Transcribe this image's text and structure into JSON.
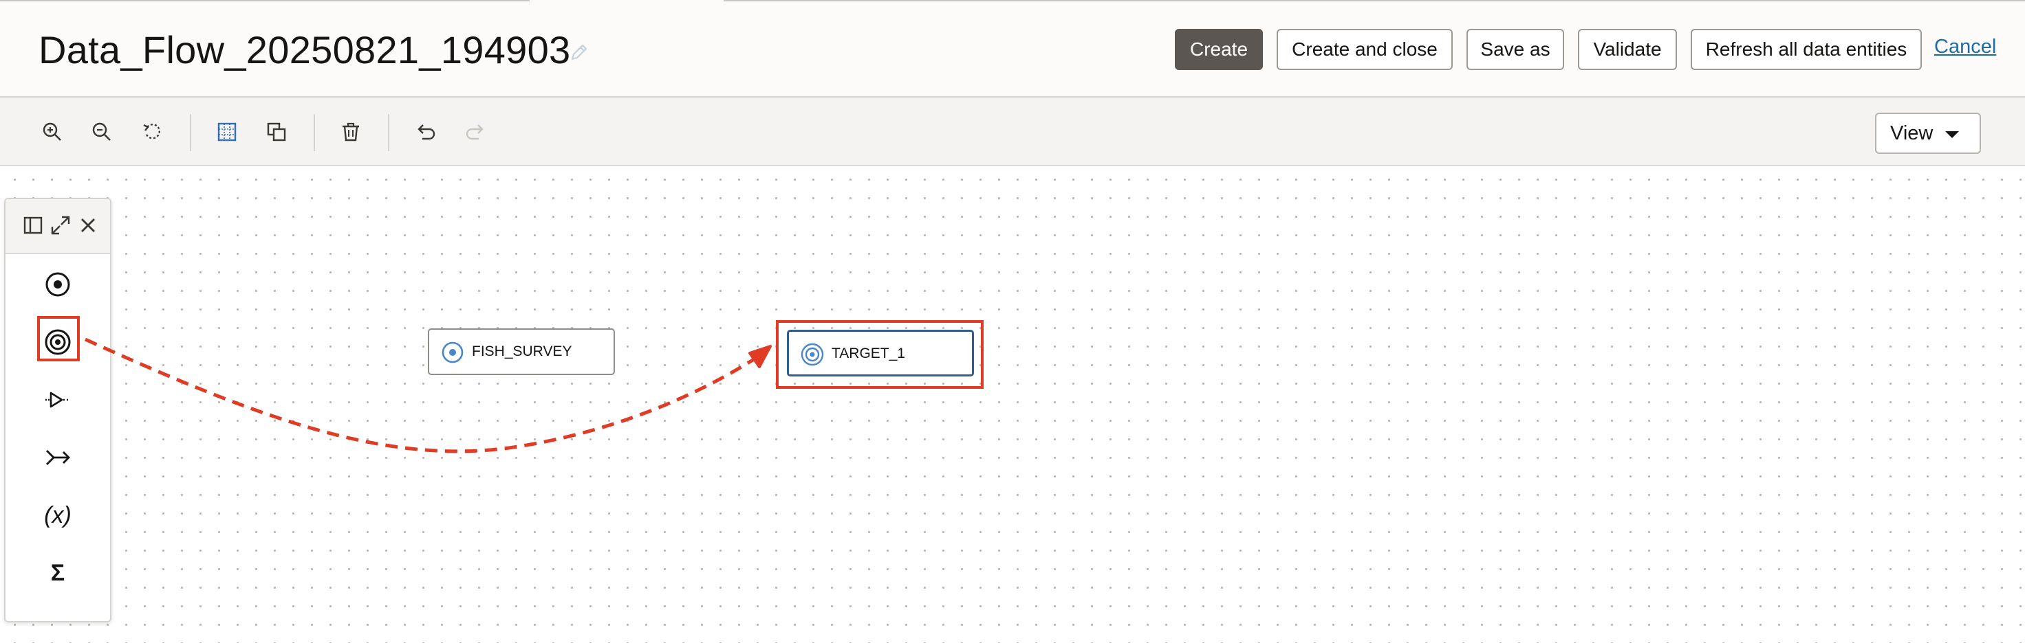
{
  "header": {
    "title": "Data_Flow_20250821_194903",
    "buttons": {
      "create": "Create",
      "create_and_close": "Create and close",
      "save_as": "Save as",
      "validate": "Validate",
      "refresh": "Refresh all data entities"
    },
    "cancel_link": "Cancel"
  },
  "toolbar": {
    "icons": [
      "zoom-in-icon",
      "zoom-out-icon",
      "reset-icon",
      "grid-icon",
      "copy-icon",
      "delete-icon",
      "undo-icon",
      "redo-icon"
    ],
    "view_label": "View"
  },
  "palette": {
    "header_icons": [
      "panel-icon",
      "expand-icon",
      "close-icon"
    ],
    "items": [
      "source-operator-icon",
      "target-operator-icon",
      "filter-operator-icon",
      "join-operator-icon",
      "expression-operator-icon",
      "aggregate-operator-icon"
    ],
    "expression_glyph": "(x)",
    "aggregate_glyph": "Σ"
  },
  "canvas": {
    "nodes": [
      {
        "label": "FISH_SURVEY",
        "type": "source"
      },
      {
        "label": "TARGET_1",
        "type": "target"
      }
    ]
  },
  "colors": {
    "primary_button": "#5b5652",
    "accent_blue": "#4a86c8",
    "annotation_red": "#e03b24",
    "link": "#1e6ba4"
  }
}
